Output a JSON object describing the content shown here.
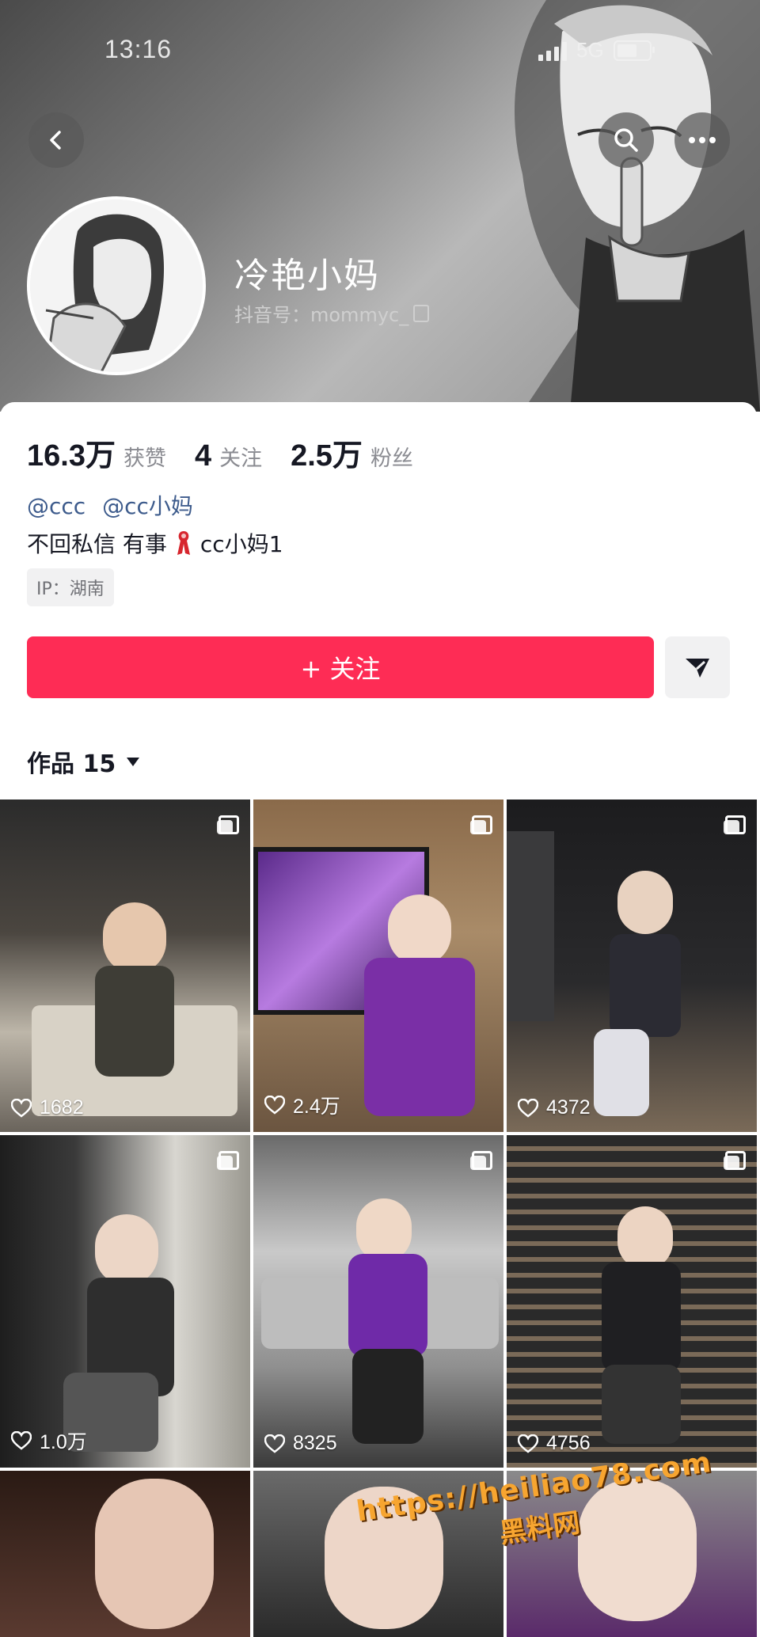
{
  "status_bar": {
    "time": "13:16",
    "network": "5G"
  },
  "profile": {
    "nickname": "冷艳小妈",
    "douyin_id": "抖音号：mommyc_",
    "stats": [
      {
        "value": "16.3万",
        "label": "获赞"
      },
      {
        "value": "4",
        "label": "关注"
      },
      {
        "value": "2.5万",
        "label": "粉丝"
      }
    ],
    "mentions": [
      "@ccc",
      "@cc小妈"
    ],
    "bio_before": "不回私信 有事",
    "bio_after": "cc小妈1",
    "ip": "IP：湖南"
  },
  "actions": {
    "follow_label": "+ 关注"
  },
  "works": {
    "tab_label": "作品 15"
  },
  "videos": [
    {
      "likes": "1682",
      "multi": true
    },
    {
      "likes": "2.4万",
      "multi": true
    },
    {
      "likes": "4372",
      "multi": true
    },
    {
      "likes": "1.0万",
      "multi": true
    },
    {
      "likes": "8325",
      "multi": true
    },
    {
      "likes": "4756",
      "multi": true
    },
    {
      "likes": "",
      "multi": false
    },
    {
      "likes": "",
      "multi": false
    },
    {
      "likes": "",
      "multi": false
    }
  ],
  "watermark": {
    "line1": "https://heiliao78.com",
    "line2": "黑料网"
  },
  "colors": {
    "accent": "#fe2c55",
    "mention": "#3d5b8c",
    "watermark": "#f7a530"
  }
}
